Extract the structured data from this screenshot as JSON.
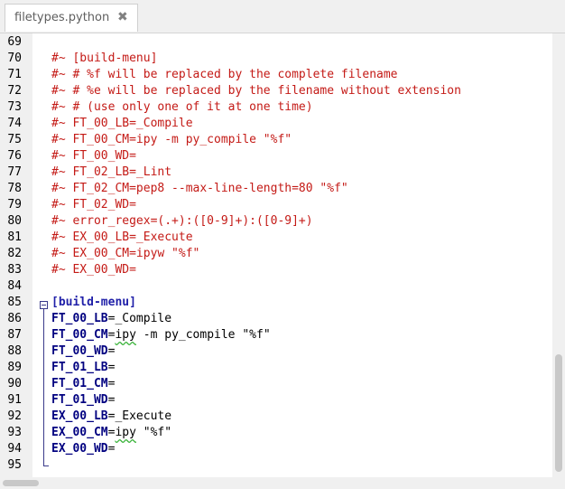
{
  "tab": {
    "title": "filetypes.python",
    "close_icon": "✖"
  },
  "lines": [
    {
      "n": "69",
      "kind": "blank",
      "text": ""
    },
    {
      "n": "70",
      "kind": "comment",
      "text": "#~ [build-menu]"
    },
    {
      "n": "71",
      "kind": "comment",
      "text": "#~ # %f will be replaced by the complete filename"
    },
    {
      "n": "72",
      "kind": "comment",
      "text": "#~ # %e will be replaced by the filename without extension"
    },
    {
      "n": "73",
      "kind": "comment",
      "text": "#~ # (use only one of it at one time)"
    },
    {
      "n": "74",
      "kind": "comment",
      "text": "#~ FT_00_LB=_Compile"
    },
    {
      "n": "75",
      "kind": "comment",
      "text": "#~ FT_00_CM=ipy -m py_compile \"%f\""
    },
    {
      "n": "76",
      "kind": "comment",
      "text": "#~ FT_00_WD="
    },
    {
      "n": "77",
      "kind": "comment",
      "text": "#~ FT_02_LB=_Lint"
    },
    {
      "n": "78",
      "kind": "comment",
      "text": "#~ FT_02_CM=pep8 --max-line-length=80 \"%f\""
    },
    {
      "n": "79",
      "kind": "comment",
      "text": "#~ FT_02_WD="
    },
    {
      "n": "80",
      "kind": "comment",
      "text": "#~ error_regex=(.+):([0-9]+):([0-9]+)"
    },
    {
      "n": "81",
      "kind": "comment",
      "text": "#~ EX_00_LB=_Execute"
    },
    {
      "n": "82",
      "kind": "comment",
      "text": "#~ EX_00_CM=ipyw \"%f\""
    },
    {
      "n": "83",
      "kind": "comment",
      "text": "#~ EX_00_WD="
    },
    {
      "n": "84",
      "kind": "blank",
      "text": ""
    },
    {
      "n": "85",
      "kind": "section",
      "text": "[build-menu]"
    },
    {
      "n": "86",
      "kind": "kv",
      "key": "FT_00_LB",
      "value": "_Compile"
    },
    {
      "n": "87",
      "kind": "kv",
      "key": "FT_00_CM",
      "value_sq": "ipy",
      "value_rest": " -m py_compile \"%f\""
    },
    {
      "n": "88",
      "kind": "kv",
      "key": "FT_00_WD",
      "value": ""
    },
    {
      "n": "89",
      "kind": "kv",
      "key": "FT_01_LB",
      "value": ""
    },
    {
      "n": "90",
      "kind": "kv",
      "key": "FT_01_CM",
      "value": ""
    },
    {
      "n": "91",
      "kind": "kv",
      "key": "FT_01_WD",
      "value": ""
    },
    {
      "n": "92",
      "kind": "kv",
      "key": "EX_00_LB",
      "value": "_Execute"
    },
    {
      "n": "93",
      "kind": "kv",
      "key": "EX_00_CM",
      "value_sq": "ipy",
      "value_rest": " \"%f\""
    },
    {
      "n": "94",
      "kind": "kv",
      "key": "EX_00_WD",
      "value": ""
    },
    {
      "n": "95",
      "kind": "blank",
      "text": ""
    }
  ],
  "colors": {
    "comment": "#c41a16",
    "key": "#000080",
    "section": "#1f1fa8",
    "squiggle": "#3cb43c"
  }
}
